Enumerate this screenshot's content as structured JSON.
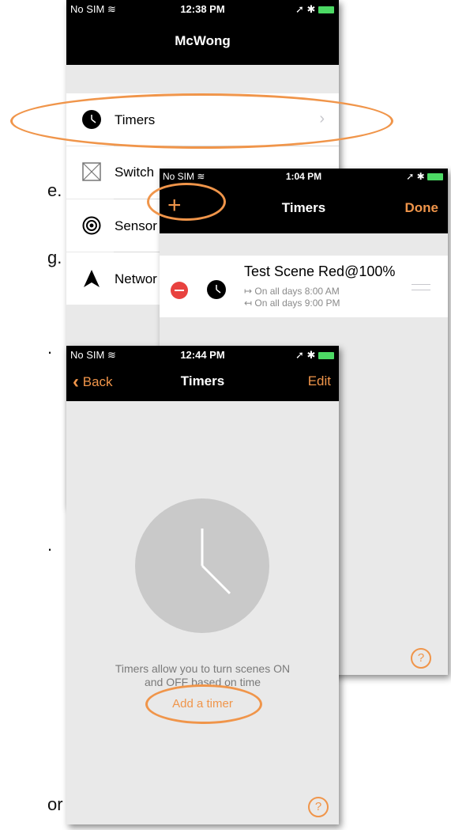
{
  "background_text": [
    "e.",
    "g.",
    ".",
    ".",
    "or"
  ],
  "screen1": {
    "status": {
      "carrier": "No SIM",
      "time": "12:38 PM"
    },
    "title": "McWong",
    "items": [
      {
        "label": "Timers",
        "icon": "clock-icon"
      },
      {
        "label": "Switch",
        "icon": "switch-icon"
      },
      {
        "label": "Sensor",
        "icon": "sensor-icon"
      },
      {
        "label": "Networ",
        "icon": "network-icon"
      }
    ]
  },
  "screen2": {
    "status": {
      "carrier": "No SIM",
      "time": "1:04 PM"
    },
    "add_label": "+",
    "title": "Timers",
    "done_label": "Done",
    "timer": {
      "name": "Test Scene Red@100%",
      "on_line": "↦ On all days 8:00 AM",
      "off_line": "↤ On all days 9:00 PM"
    },
    "help_label": "?"
  },
  "screen3": {
    "status": {
      "carrier": "No SIM",
      "time": "12:44 PM"
    },
    "back_label": "Back",
    "title": "Timers",
    "edit_label": "Edit",
    "description_line1": "Timers allow you to turn scenes ON",
    "description_line2": "and OFF based on time",
    "add_timer_label": "Add a timer",
    "help_label": "?"
  },
  "colors": {
    "accent": "#f0954a",
    "nav_bg": "#000000",
    "delete_red": "#e8423f",
    "battery": "#4cd964"
  }
}
